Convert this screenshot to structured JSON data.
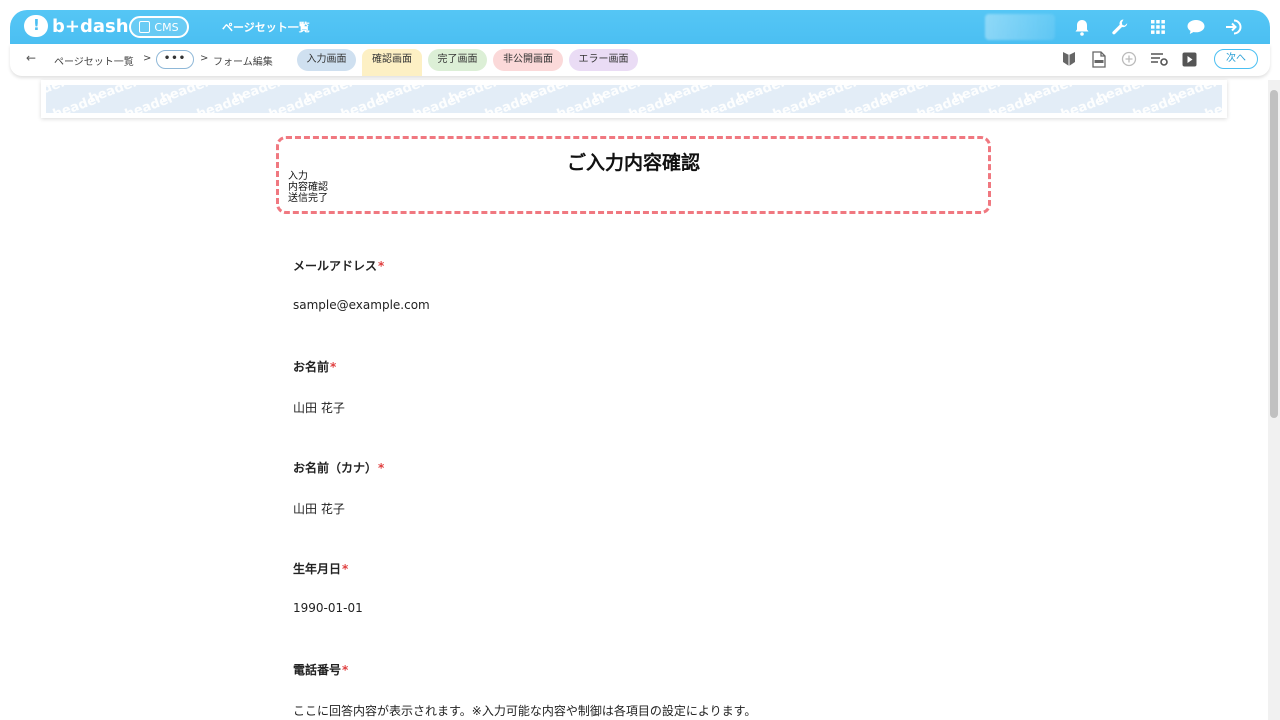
{
  "header": {
    "logo_text": "b+dash",
    "app_pill": "CMS",
    "page_title": "ページセット一覧",
    "icons": [
      "bell-icon",
      "wrench-icon",
      "grid-icon",
      "chat-icon",
      "logout-icon"
    ]
  },
  "toolbar": {
    "back_icon": "arrow-left-icon",
    "breadcrumb_root": "ページセット一覧",
    "separator": ">",
    "ellipsis": "•••",
    "breadcrumb_current": "フォーム編集",
    "tabs": [
      {
        "label": "入力画面",
        "color": "#cfe0f0"
      },
      {
        "label": "確認画面",
        "color": "#fdf0c4"
      },
      {
        "label": "完了画面",
        "color": "#dcefd6"
      },
      {
        "label": "非公開画面",
        "color": "#fbd9d9"
      },
      {
        "label": "エラー画面",
        "color": "#eadcf5"
      }
    ],
    "active_tab": "確認画面",
    "right_icons": [
      "beginner-mark-icon",
      "html-file-icon",
      "add-circle-icon",
      "settings-list-icon",
      "play-icon"
    ],
    "next_label": "次へ"
  },
  "header_band": {
    "watermark": "header"
  },
  "content": {
    "title": "ご入力内容確認",
    "steps": [
      "入力",
      "内容確認",
      "送信完了"
    ],
    "fields": [
      {
        "label": "メールアドレス",
        "required": "*",
        "value": "sample@example.com"
      },
      {
        "label": "お名前",
        "required": "*",
        "value": "山田 花子"
      },
      {
        "label": "お名前（カナ）",
        "required": "*",
        "value": "山田 花子"
      },
      {
        "label": "生年月日",
        "required": "*",
        "value": "1990-01-01"
      },
      {
        "label": "電話番号",
        "required": "*",
        "value": "ここに回答内容が表示されます。※入力可能な内容や制御は各項目の設定によります。"
      }
    ]
  },
  "colors": {
    "brand": "#4bbff2",
    "step_border": "#f07880",
    "required": "#e04040"
  }
}
